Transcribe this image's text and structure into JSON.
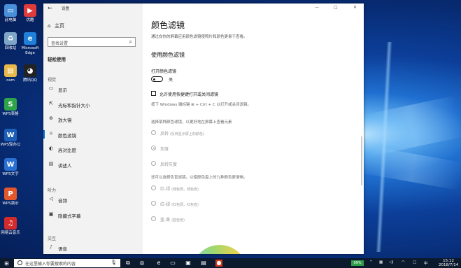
{
  "desktop": {
    "icons": [
      {
        "label": "此电脑",
        "icon": "computer-icon",
        "color": "#4a90d9"
      },
      {
        "label": "优酷",
        "icon": "youku-icon",
        "color": "#e03a3a"
      },
      {
        "label": "回收站",
        "icon": "recycle-bin-icon",
        "color": "#7fa6c8"
      },
      {
        "label": "Microsoft Edge",
        "icon": "edge-icon",
        "color": "#1f7fd9"
      },
      {
        "label": "cam",
        "icon": "folder-icon",
        "color": "#e8b84a"
      },
      {
        "label": "腾讯QQ",
        "icon": "qq-icon",
        "color": "#222222"
      },
      {
        "label": "WPS表格",
        "icon": "wps-sheet-icon",
        "color": "#2ea34a"
      },
      {
        "label": "WPS轻办公",
        "icon": "wps-office-icon",
        "color": "#1d5fb8"
      },
      {
        "label": "WPS文字",
        "icon": "wps-writer-icon",
        "color": "#2a6fd1"
      },
      {
        "label": "WPS演示",
        "icon": "wps-present-icon",
        "color": "#e2572b"
      },
      {
        "label": "网易云音乐",
        "icon": "netease-music-icon",
        "color": "#d32b2b"
      }
    ]
  },
  "window": {
    "title": "设置",
    "back": "←",
    "controls": {
      "minimize": "—",
      "maximize": "□",
      "close": "✕"
    },
    "sidebar": {
      "home": "主页",
      "search_placeholder": "查找设置",
      "section": "轻松使用",
      "groups": {
        "vision": "视觉",
        "hearing": "听力",
        "interaction": "交互"
      },
      "items": [
        {
          "label": "显示",
          "icon": "display-icon"
        },
        {
          "label": "光标和指针大小",
          "icon": "cursor-icon"
        },
        {
          "label": "放大镜",
          "icon": "magnifier-icon"
        },
        {
          "label": "颜色滤镜",
          "icon": "color-filter-icon",
          "selected": true
        },
        {
          "label": "高对比度",
          "icon": "contrast-icon"
        },
        {
          "label": "讲述人",
          "icon": "narrator-icon"
        },
        {
          "label": "音频",
          "icon": "audio-icon"
        },
        {
          "label": "隐藏式字幕",
          "icon": "captions-icon"
        },
        {
          "label": "语音",
          "icon": "speech-icon"
        }
      ]
    },
    "content": {
      "title": "颜色滤镜",
      "description": "通过向你的屏幕应用颜色滤镜使照片和颜色更易于查看。",
      "subtitle": "使用颜色滤镜",
      "toggle_label": "打开颜色滤镜",
      "toggle_state": "关",
      "shortcut_checkbox": "允许使用快捷键打开或关闭滤镜",
      "shortcut_hint": "按下 Windows 徽标键 ⊞ + Ctrl + C 以打开或关闭滤镜。",
      "filter_prompt": "选择某种颜色滤镜，以更好地在屏幕上查看元素",
      "filters": [
        {
          "label": "反转",
          "note": "(反转显示屏上的颜色)",
          "selected": false
        },
        {
          "label": "灰度",
          "note": "",
          "selected": true
        },
        {
          "label": "反转灰度",
          "note": "",
          "selected": false
        }
      ],
      "colorblind_prompt": "还可以选择色盲滤镜，以使颜色盘上的九种颜色更清晰。",
      "colorblind": [
        {
          "label": "红-绿",
          "note": "(绿色弱，绿色盲)"
        },
        {
          "label": "红-绿",
          "note": "(红色弱，红色盲)"
        },
        {
          "label": "蓝-黄",
          "note": "(蓝色盲)"
        }
      ]
    }
  },
  "taskbar": {
    "search_placeholder": "在这里输入你要搜索的内容",
    "battery": "99%",
    "language": "中",
    "time": "15:12",
    "date": "2018/7/14"
  }
}
